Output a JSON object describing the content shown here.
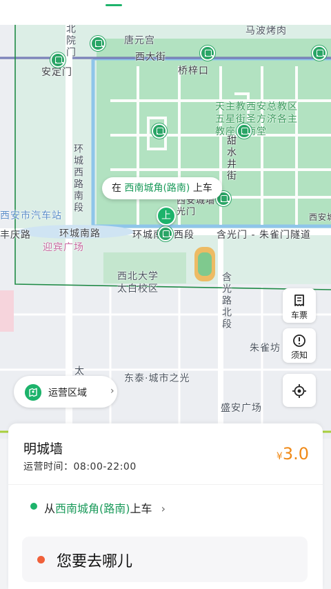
{
  "map": {
    "labels": {
      "beiyuanmen": "北院门",
      "tangyuangong": "唐元宫",
      "mabo": "马波烤肉",
      "xidajie": "西大街",
      "andingmen": "安定门",
      "qiaozikou": "桥梓口",
      "cathedral": "天主教西安总教区五星街圣方济各主教座堂南堂",
      "huanchengxi_nan": "环城西路南段",
      "tianshui": "甜水井街",
      "xian_cheng": "西安城墙含光门",
      "xian_bus": "西安市汽车站",
      "fengqing": "丰庆路",
      "huanchengnan": "环城南路",
      "huanchengnan_xi": "环城南路西段",
      "hanguangmen_zhuque": "含光门 - 朱雀门隧道",
      "yingbin": "迎宾广场",
      "xibei_univ": "西北大学太白校区",
      "hanguang_bei": "含光路北段",
      "zhuquefang": "朱雀坊",
      "dongtai": "东泰·城市之光",
      "shengan": "盛安广场",
      "taibai": "太白路",
      "xian_right": "西安城"
    }
  },
  "pickup_bubble": {
    "prefix": "在",
    "stop": "西南城角(路南)",
    "suffix": "上车"
  },
  "pickup_marker": "上",
  "side_buttons": {
    "ticket": "车票",
    "notice": "须知"
  },
  "area_button": {
    "label": "运营区域",
    "chevron": "›"
  },
  "card": {
    "route_name": "明城墙",
    "hours": "运营时间：08:00-22:00",
    "price_currency": "¥",
    "price_value": "3.0",
    "from_prefix": "从",
    "from_stop": "西南城角(路南)",
    "from_suffix": "上车",
    "from_chevron": "›",
    "destination_placeholder": "您要去哪儿"
  },
  "colors": {
    "accent": "#1db36b",
    "price": "#f08a18",
    "destination_dot": "#f0603a"
  }
}
